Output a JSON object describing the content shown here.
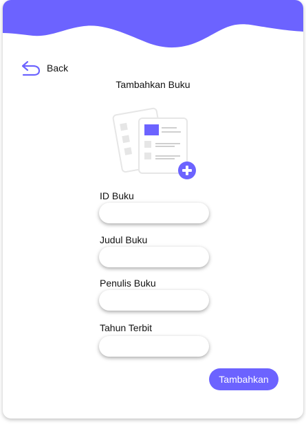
{
  "colors": {
    "accent": "#6c63ff",
    "light_gray": "#e6e6e6",
    "mid_gray": "#cfcfcf"
  },
  "nav": {
    "back_label": "Back",
    "back_icon": "back-arrow-icon"
  },
  "page": {
    "title": "Tambahkan Buku",
    "illustration": "add-document-illustration"
  },
  "form": {
    "fields": [
      {
        "label": "ID Buku",
        "value": ""
      },
      {
        "label": "Judul Buku",
        "value": ""
      },
      {
        "label": "Penulis Buku",
        "value": ""
      },
      {
        "label": "Tahun Terbit",
        "value": ""
      }
    ],
    "submit_label": "Tambahkan"
  }
}
